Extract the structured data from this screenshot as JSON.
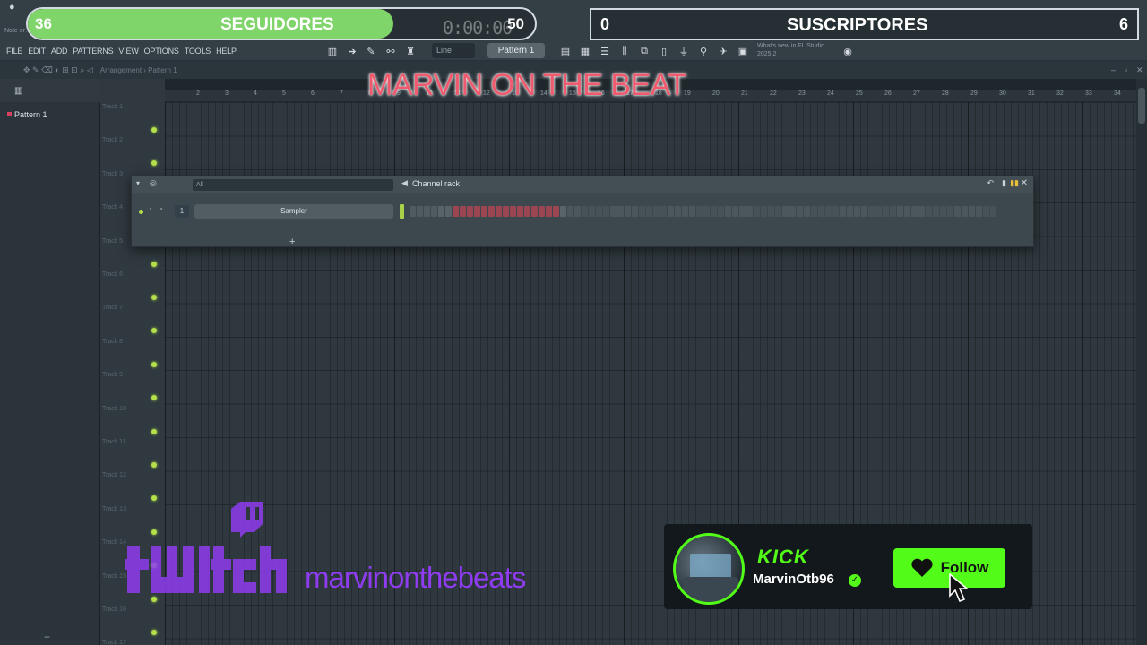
{
  "app": {
    "hint": "Note or…",
    "time": "0:00:00"
  },
  "menu": [
    "FILE",
    "EDIT",
    "ADD",
    "PATTERNS",
    "VIEW",
    "OPTIONS",
    "TOOLS",
    "HELP"
  ],
  "toolbar": {
    "snap": "Line",
    "pattern": "Pattern 1",
    "news": "What's new in FL Studio 2025.2"
  },
  "playlist": {
    "breadcrumb": "Arrangement › Pattern 1"
  },
  "browser": {
    "patterns": [
      "Pattern 1"
    ]
  },
  "ruler": [
    "2",
    "3",
    "4",
    "5",
    "6",
    "7",
    "8",
    "9",
    "10",
    "11",
    "12",
    "13",
    "14",
    "15",
    "16",
    "17",
    "18",
    "19",
    "20",
    "21",
    "22",
    "23",
    "24",
    "25",
    "26",
    "27",
    "28",
    "29",
    "30",
    "31",
    "32",
    "33",
    "34"
  ],
  "tracks": [
    "Track 1",
    "Track 2",
    "Track 3",
    "Track 4",
    "Track 5",
    "Track 6",
    "Track 7",
    "Track 8",
    "Track 9",
    "Track 10",
    "Track 11",
    "Track 12",
    "Track 13",
    "Track 14",
    "Track 15",
    "Track 16",
    "Track 17"
  ],
  "channel_rack": {
    "title": "Channel rack",
    "filter": "All",
    "channel": {
      "number": "1",
      "name": "Sampler"
    },
    "steps_on": [
      0,
      0,
      0,
      0,
      0,
      0,
      1,
      1,
      1,
      1,
      1,
      1,
      1,
      1,
      1,
      1,
      1,
      1,
      1,
      1,
      1
    ],
    "colors": {
      "step_red": "#9b4651",
      "step_dark": "#4f5a61",
      "step_light": "#58636a"
    }
  },
  "overlay": {
    "followers": {
      "current": "36",
      "label": "SEGUIDORES",
      "goal": "50",
      "progress": 0.72
    },
    "subscribers": {
      "current": "0",
      "label": "SUSCRIPTORES",
      "goal": "6"
    },
    "banner": "MARVIN ON THE BEAT",
    "twitch": {
      "wordmark": "twitch",
      "username": "marvinonthebeats",
      "color": "#8f3cf0"
    },
    "kick": {
      "logo": "KICK",
      "username": "MarvinOtb96",
      "follow": "Follow",
      "color": "#53fc18"
    }
  }
}
